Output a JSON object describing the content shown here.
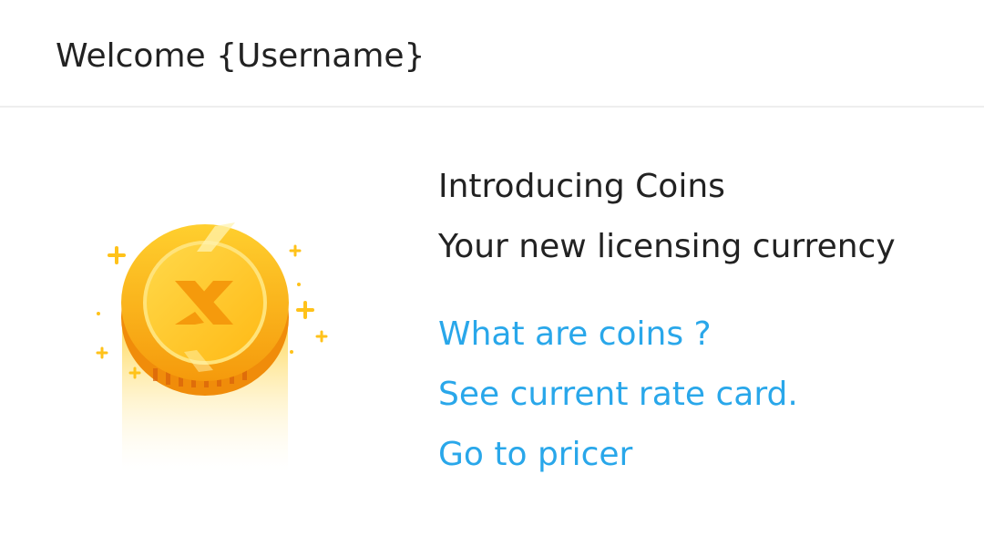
{
  "header": {
    "title": "Welcome {Username}"
  },
  "illustration": {
    "icon": "coin-icon",
    "coin_color": "#ffc21a",
    "coin_dark": "#f39c12",
    "glyph": "X"
  },
  "intro": {
    "title": "Introducing Coins",
    "subtitle": "Your new licensing currency"
  },
  "links": [
    {
      "label": "What are coins ?"
    },
    {
      "label": "See current rate card."
    },
    {
      "label": "Go to pricer"
    }
  ],
  "colors": {
    "link": "#29a7ea",
    "text": "#222222",
    "divider": "#eeeeee"
  }
}
